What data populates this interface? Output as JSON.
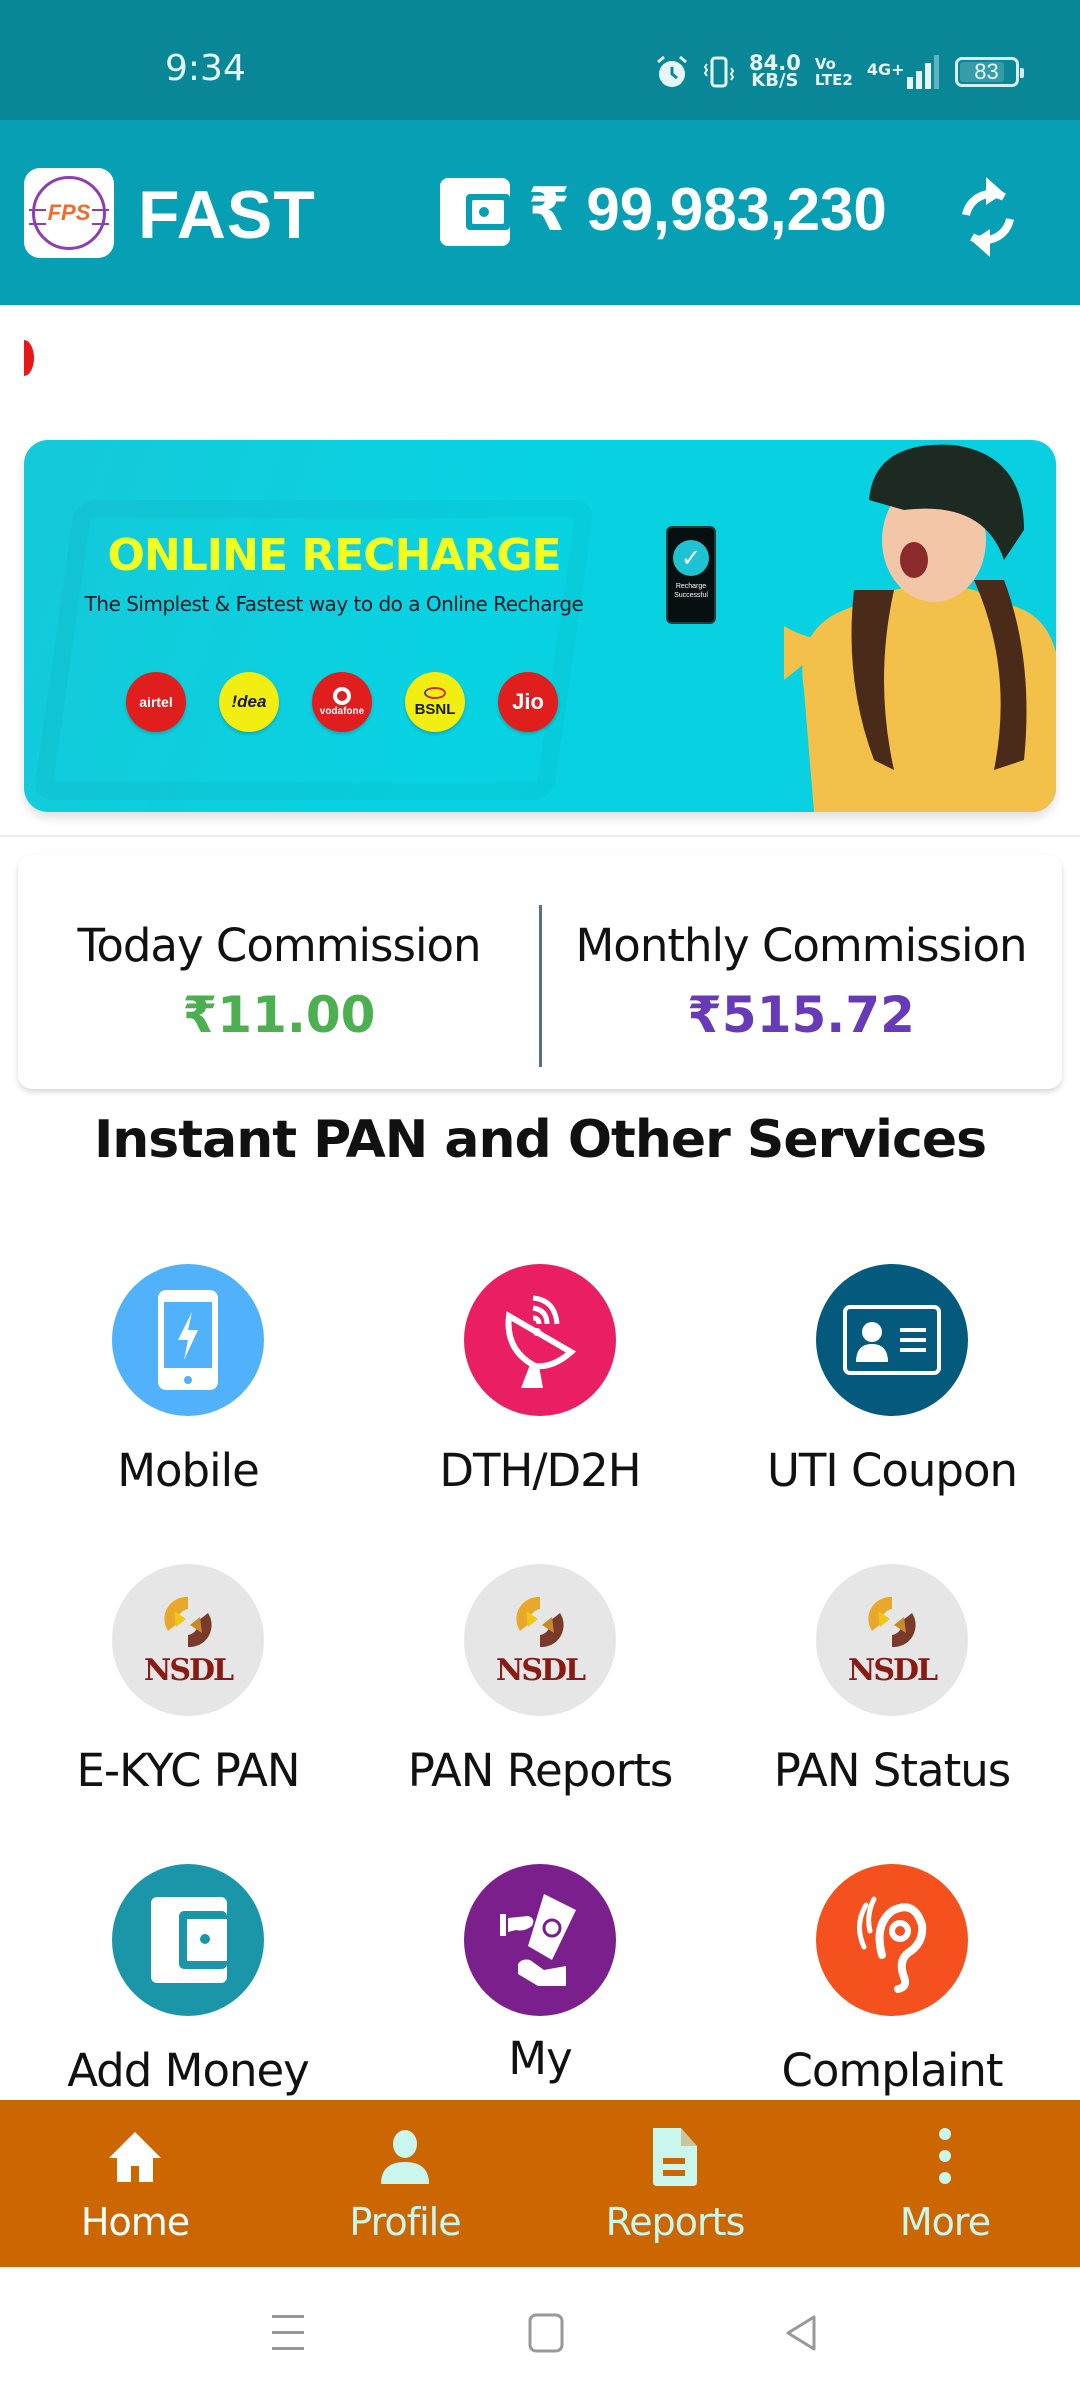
{
  "status_bar": {
    "time": "9:34",
    "net_speed": "84.0",
    "net_unit": "KB/S",
    "volte_top": "Vo",
    "volte_bottom": "LTE2",
    "network": "4G+",
    "battery": "83",
    "battery_level_percent": 83
  },
  "header": {
    "logo_text": "FPS",
    "brand": "FAST",
    "balance": "₹ 99,983,230",
    "icons": [
      "wallet-icon",
      "refresh-icon"
    ]
  },
  "banner": {
    "title": "ONLINE RECHARGE",
    "subtitle": "The Simplest & Fastest way to do a Online Recharge",
    "phone_text_1": "Recharge",
    "phone_text_2": "Successful",
    "operators": [
      {
        "name": "airtel",
        "label": "airtel"
      },
      {
        "name": "idea",
        "label": "!dea"
      },
      {
        "name": "vodafone",
        "label": "vodafone"
      },
      {
        "name": "bsnl",
        "label": "BSNL"
      },
      {
        "name": "jio",
        "label": "Jio"
      }
    ]
  },
  "commission": {
    "today_label": "Today Commission",
    "today_value": "₹11.00",
    "monthly_label": "Monthly Commission",
    "monthly_value": "₹515.72",
    "colors": {
      "today": "#4caf50",
      "monthly": "#673ab7"
    }
  },
  "services": {
    "title": "Instant PAN and Other Services",
    "items": [
      {
        "label": "Mobile",
        "icon": "mobile-recharge-icon",
        "color": "#52b1fb"
      },
      {
        "label": "DTH/D2H",
        "icon": "satellite-dish-icon",
        "color": "#e91e63"
      },
      {
        "label": "UTI Coupon",
        "icon": "id-card-icon",
        "color": "#045a7d"
      },
      {
        "label": "E-KYC PAN",
        "icon": "nsdl-logo-icon",
        "color": "#e6e6e6"
      },
      {
        "label": "PAN Reports",
        "icon": "nsdl-logo-icon",
        "color": "#e6e6e6"
      },
      {
        "label": "PAN Status",
        "icon": "nsdl-logo-icon",
        "color": "#e6e6e6"
      },
      {
        "label": "Add Money",
        "icon": "wallet-icon",
        "color": "#1a96a8"
      },
      {
        "label": "My",
        "icon": "money-hand-icon",
        "color": "#7b1f8c"
      },
      {
        "label": "Complaint",
        "icon": "ear-icon",
        "color": "#f4511e"
      }
    ],
    "nsdl_word": "NSDL"
  },
  "bottom_nav": {
    "bg_color": "#cc6600",
    "items": [
      {
        "label": "Home",
        "icon": "home-icon",
        "active": true
      },
      {
        "label": "Profile",
        "icon": "profile-icon",
        "active": false
      },
      {
        "label": "Reports",
        "icon": "reports-icon",
        "active": false
      },
      {
        "label": "More",
        "icon": "more-icon",
        "active": false
      }
    ]
  },
  "system_nav": {
    "buttons": [
      "recents",
      "home",
      "back"
    ]
  }
}
